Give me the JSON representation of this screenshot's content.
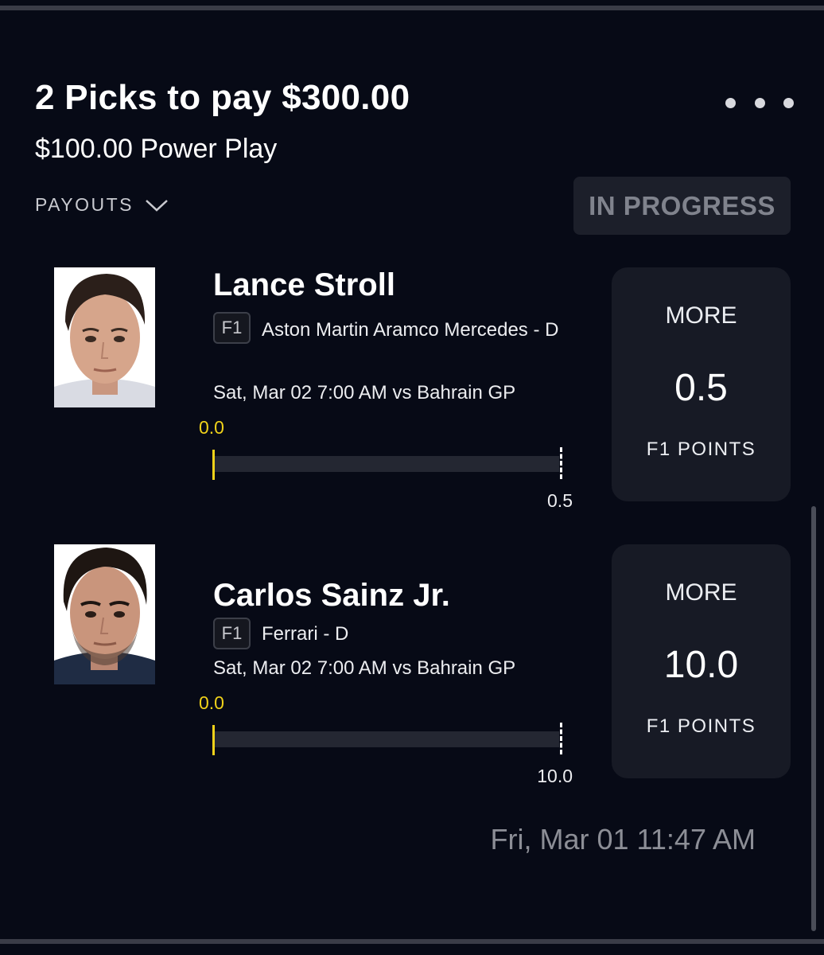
{
  "header": {
    "title": "2 Picks to pay $300.00",
    "subtitle": "$100.00 Power Play",
    "payouts_label": "PAYOUTS",
    "status": "IN PROGRESS"
  },
  "picks": [
    {
      "player": "Lance Stroll",
      "league": "F1",
      "team": "Aston Martin Aramco Mercedes - D",
      "game": "Sat, Mar 02 7:00 AM  vs Bahrain GP",
      "current": "0.0",
      "target": "0.5",
      "progress_fraction": 0,
      "direction": "MORE",
      "line": "0.5",
      "stat": "F1 POINTS"
    },
    {
      "player": "Carlos Sainz Jr.",
      "league": "F1",
      "team": "Ferrari - D",
      "game": "Sat, Mar 02 7:00 AM  vs Bahrain GP",
      "current": "0.0",
      "target": "10.0",
      "progress_fraction": 0,
      "direction": "MORE",
      "line": "10.0",
      "stat": "F1 POINTS"
    }
  ],
  "footer": {
    "timestamp": "Fri, Mar 01 11:47 AM"
  },
  "colors": {
    "background": "#070a16",
    "accent": "#f0d21a",
    "card": "#171a25",
    "badge": "#1c1f2a"
  },
  "icons": [
    "more-horizontal-icon",
    "chevron-down-icon"
  ]
}
